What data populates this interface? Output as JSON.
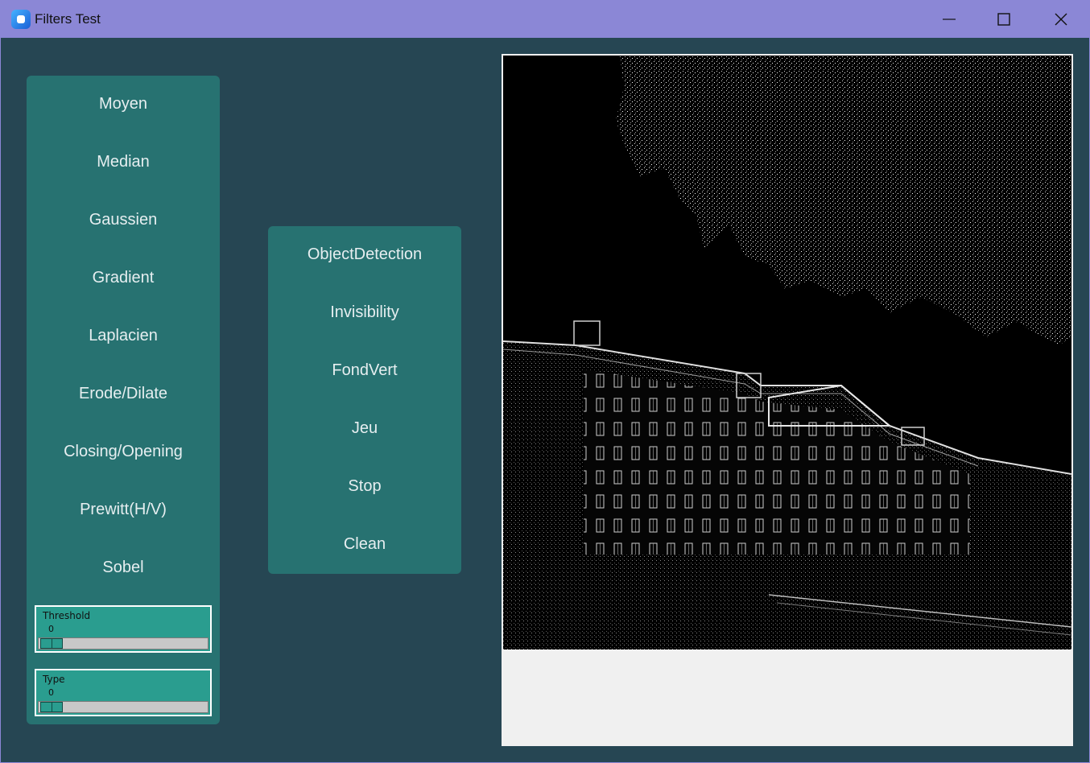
{
  "window": {
    "title": "Filters Test"
  },
  "left_panel": {
    "buttons": [
      "Moyen",
      "Median",
      "Gaussien",
      "Gradient",
      "Laplacien",
      "Erode/Dilate",
      "Closing/Opening",
      "Prewitt(H/V)",
      "Sobel"
    ],
    "threshold": {
      "label": "Threshold",
      "value": "0"
    },
    "type": {
      "label": "Type",
      "value": "0"
    }
  },
  "middle_panel": {
    "buttons": [
      "ObjectDetection",
      "Invisibility",
      "FondVert",
      "Jeu",
      "Stop",
      "Clean"
    ]
  },
  "colors": {
    "background": "#264653",
    "panel": "#277271",
    "slider": "#2a9d8f",
    "titlebar": "#8b87d6"
  },
  "image": {
    "description_icon": "edge-detected-building-image"
  }
}
